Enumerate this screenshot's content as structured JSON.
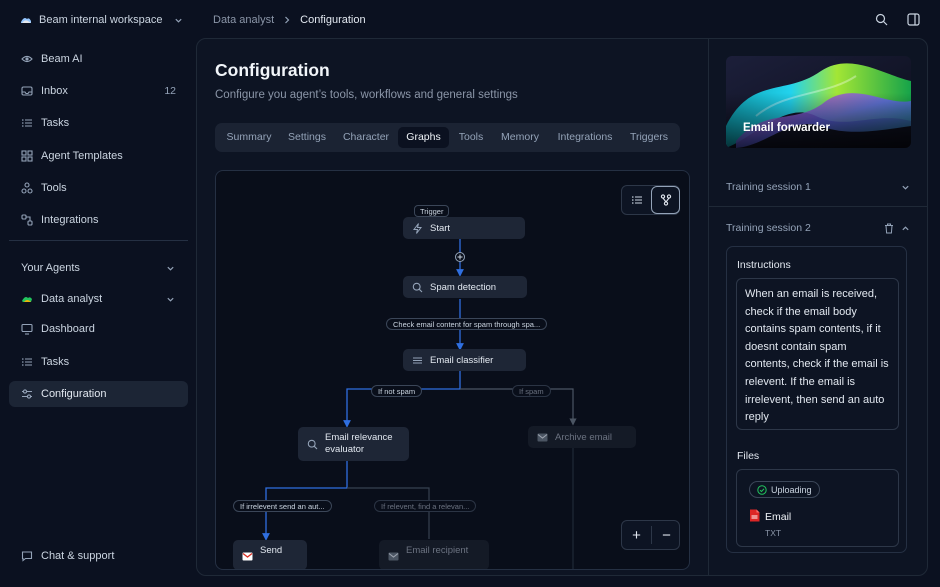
{
  "sidebar": {
    "workspace": "Beam internal workspace",
    "items": [
      {
        "label": "Beam AI"
      },
      {
        "label": "Inbox",
        "count": "12"
      },
      {
        "label": "Tasks"
      },
      {
        "label": "Agent Templates"
      },
      {
        "label": "Tools"
      },
      {
        "label": "Integrations"
      }
    ],
    "agents_heading": "Your Agents",
    "agent": {
      "name": "Data analyst",
      "items": [
        {
          "label": "Dashboard"
        },
        {
          "label": "Tasks"
        },
        {
          "label": "Configuration"
        }
      ]
    },
    "support": "Chat & support"
  },
  "breadcrumb": [
    "Data analyst",
    "Configuration"
  ],
  "page": {
    "title": "Configuration",
    "subtitle": "Configure you agent’s tools, workflows and general settings"
  },
  "tabs": [
    {
      "label": "Summary"
    },
    {
      "label": "Settings"
    },
    {
      "label": "Character"
    },
    {
      "label": "Graphs",
      "active": true
    },
    {
      "label": "Tools"
    },
    {
      "label": "Memory"
    },
    {
      "label": "Integrations"
    },
    {
      "label": "Triggers"
    }
  ],
  "graph": {
    "trigger_tag": "Trigger",
    "nodes": {
      "start": "Start",
      "spam_detection": "Spam detection",
      "email_classifier": "Email classifier",
      "relevance_line1": "Email relevance",
      "relevance_line2": "evaluator",
      "archive": "Archive email",
      "send": "Send",
      "recipient": "Email recipient"
    },
    "edges": {
      "check_spam": "Check email content for spam through spa...",
      "if_not_spam": "If not spam",
      "if_spam": "If spam",
      "if_irrelevant": "If irrelevent send an aut...",
      "if_relevant": "If relevent, find a relevan..."
    },
    "zoom_in": "+",
    "zoom_out": "−"
  },
  "right": {
    "hero_title": "Email forwarder",
    "session1": "Training session 1",
    "session2": "Training session 2",
    "instructions_label": "Instructions",
    "instructions_text": "When an email is received, check if the email body contains spam contents, if it doesnt contain spam contents, check if the email is relevent. If the email is irrelevent, then send an auto reply",
    "files_label": "Files",
    "upload_status": "Uploading",
    "file_name": "Email",
    "file_type": "TXT"
  },
  "colors": {
    "background": "#0b1120",
    "panel": "#0d1423",
    "accent_blue": "#2f6fe0",
    "gmail_red": "#d93025"
  }
}
